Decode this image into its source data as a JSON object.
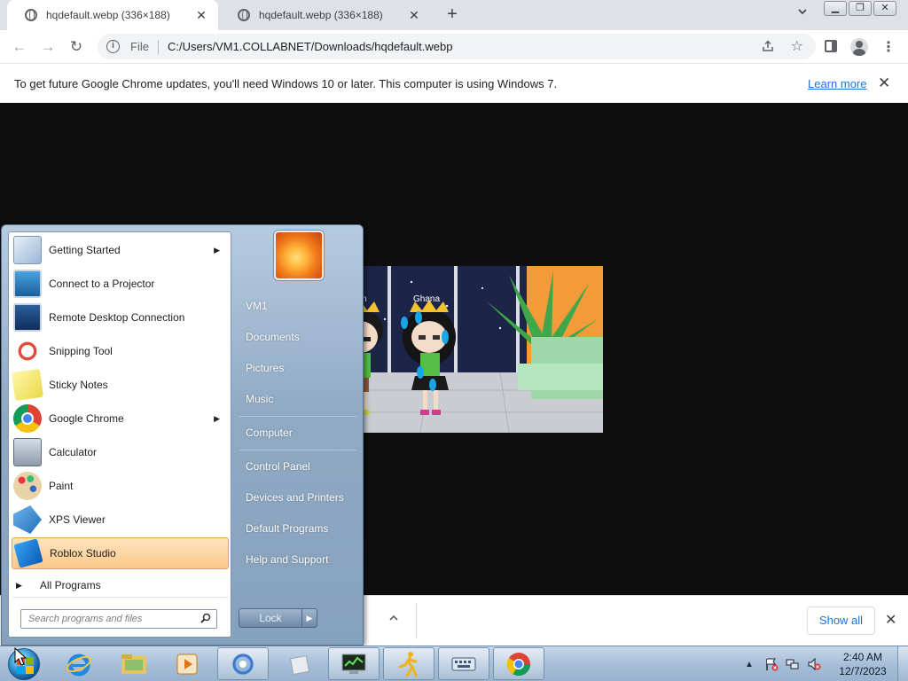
{
  "browser": {
    "tabs": [
      {
        "title": "hqdefault.webp (336×188)",
        "active": true
      },
      {
        "title": "hqdefault.webp (336×188)",
        "active": false
      }
    ],
    "address": {
      "scheme_label": "File",
      "url": "C:/Users/VM1.COLLABNET/Downloads/hqdefault.webp"
    },
    "infobar": {
      "message": "To get future Google Chrome updates, you'll need Windows 10 or later. This computer is using Windows 7.",
      "link": "Learn more"
    },
    "shelf": {
      "show_all": "Show all"
    }
  },
  "image": {
    "labels": [
      "Alvin",
      "Ghana"
    ]
  },
  "start_menu": {
    "programs": [
      {
        "label": "Getting Started",
        "has_submenu": true
      },
      {
        "label": "Connect to a Projector",
        "has_submenu": false
      },
      {
        "label": "Remote Desktop Connection",
        "has_submenu": false
      },
      {
        "label": "Snipping Tool",
        "has_submenu": false
      },
      {
        "label": "Sticky Notes",
        "has_submenu": false
      },
      {
        "label": "Google Chrome",
        "has_submenu": true
      },
      {
        "label": "Calculator",
        "has_submenu": false
      },
      {
        "label": "Paint",
        "has_submenu": false
      },
      {
        "label": "XPS Viewer",
        "has_submenu": false
      },
      {
        "label": "Roblox Studio",
        "has_submenu": false,
        "highlighted": true
      }
    ],
    "all_programs": "All Programs",
    "search_placeholder": "Search programs and files",
    "right_items": [
      "VM1",
      "Documents",
      "Pictures",
      "Music",
      "Computer",
      "Control Panel",
      "Devices and Printers",
      "Default Programs",
      "Help and Support"
    ],
    "shutdown_label": "Lock"
  },
  "taskbar": {
    "clock_time": "2:40 AM",
    "clock_date": "12/7/2023"
  },
  "colors": {
    "accent_link": "#1a73e8",
    "highlight_orange": "#fbc98a",
    "taskbar_blue": "#a7bfd8"
  }
}
